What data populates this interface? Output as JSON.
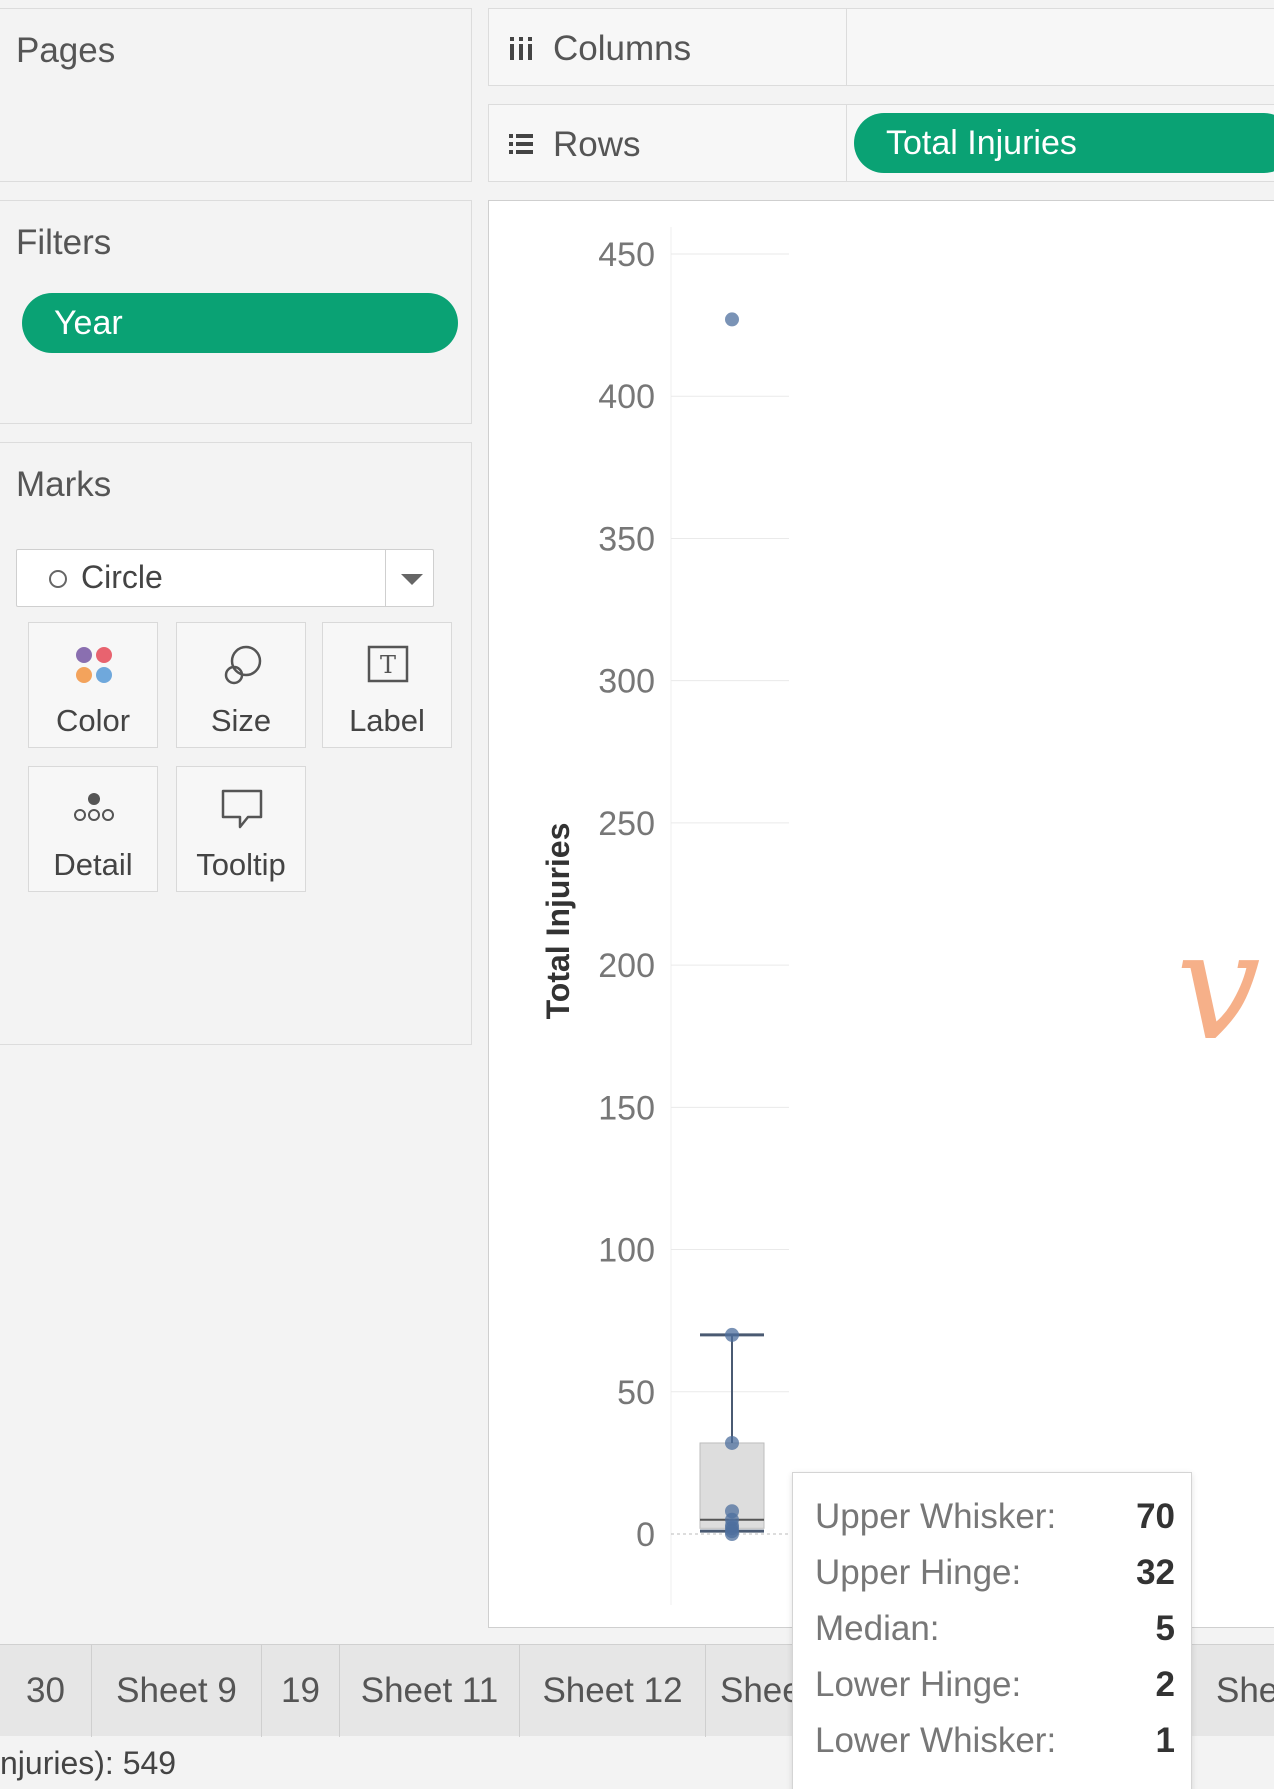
{
  "cards": {
    "pages_title": "Pages",
    "filters_title": "Filters",
    "filters_pill": "Year",
    "marks_title": "Marks",
    "marks_type": "Circle",
    "mark_buttons": [
      "Color",
      "Size",
      "Label",
      "Detail",
      "Tooltip"
    ]
  },
  "shelves": {
    "columns_label": "Columns",
    "rows_label": "Rows",
    "rows_pill": "Total Injuries"
  },
  "colors": {
    "pill_green": "#0aa274",
    "mark_blue": "#4e6f9e"
  },
  "chart_data": {
    "type": "box",
    "ylabel": "Total Injuries",
    "ylim": [
      0,
      450
    ],
    "yticks": [
      0,
      50,
      100,
      150,
      200,
      250,
      300,
      350,
      400,
      450
    ],
    "grid": true,
    "box": {
      "upper_whisker": 70,
      "upper_hinge": 32,
      "median": 5,
      "lower_hinge": 2,
      "lower_whisker": 1
    },
    "points": [
      427,
      70,
      32,
      8,
      5,
      3,
      2,
      1,
      0
    ]
  },
  "tooltip": {
    "rows": [
      {
        "key": "Upper Whisker:",
        "value": "70"
      },
      {
        "key": "Upper Hinge:",
        "value": "32"
      },
      {
        "key": "Median:",
        "value": "5"
      },
      {
        "key": "Lower Hinge:",
        "value": "2"
      },
      {
        "key": "Lower Whisker:",
        "value": "1"
      }
    ]
  },
  "tabs": [
    "30",
    "Sheet 9",
    "19",
    "Sheet 11",
    "Sheet 12",
    "Shee",
    "She"
  ],
  "status": {
    "text": "njuries): 549"
  },
  "watermark": "v"
}
